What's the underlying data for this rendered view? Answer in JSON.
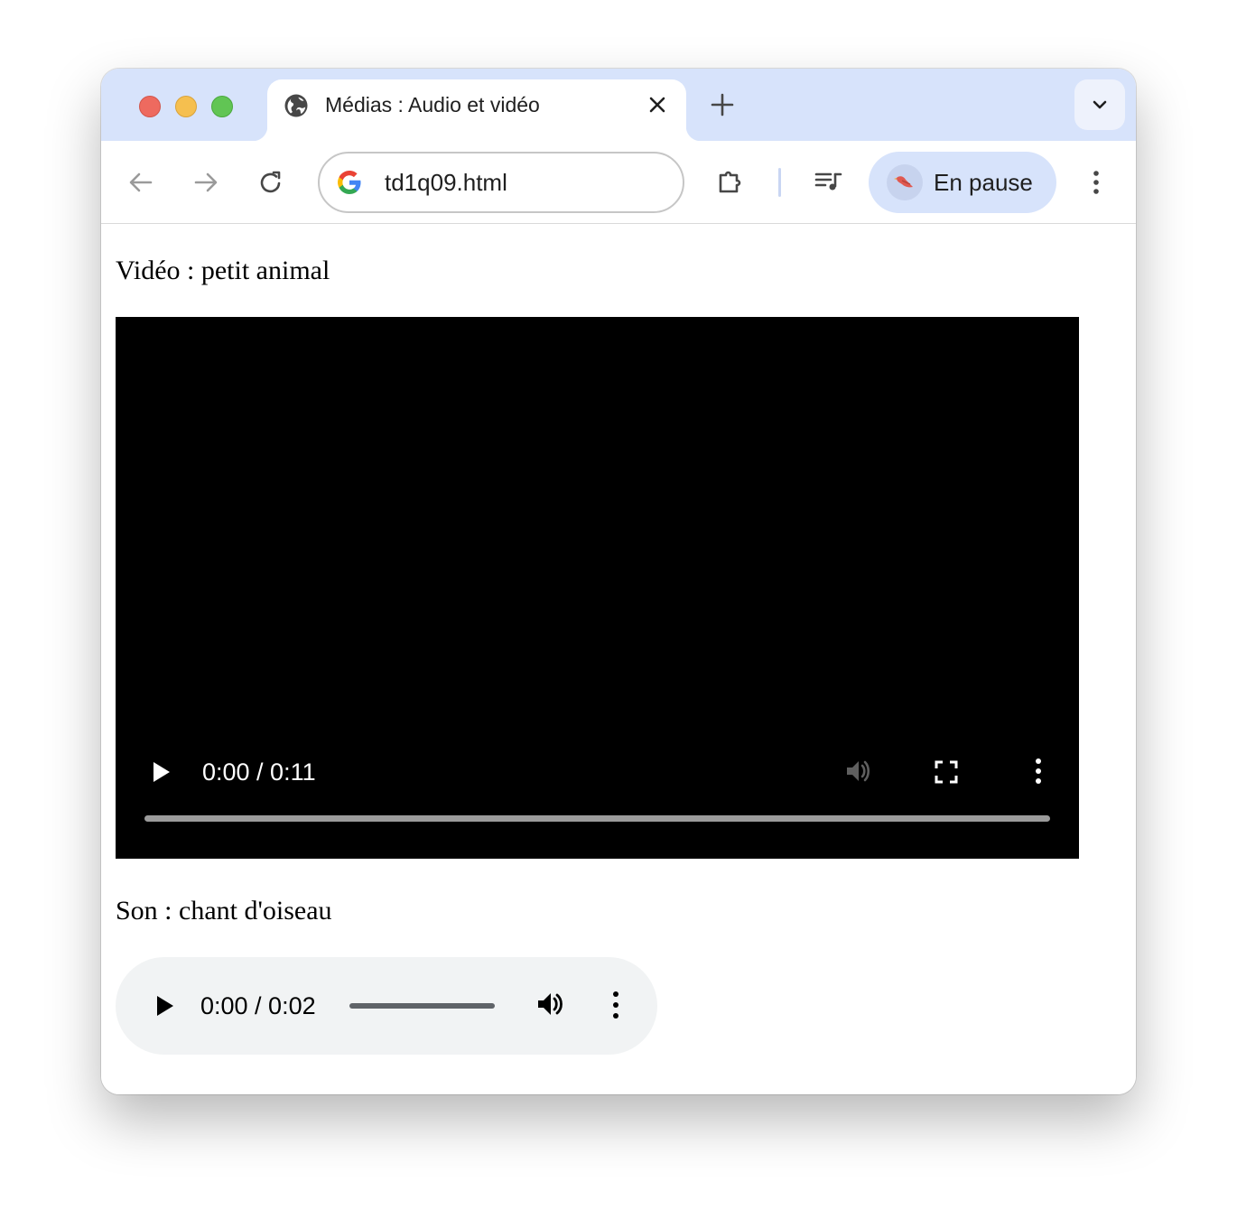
{
  "tab": {
    "title": "Médias : Audio et vidéo",
    "favicon": "globe-icon"
  },
  "toolbar": {
    "url": "td1q09.html",
    "profile_label": "En pause",
    "icons": [
      "back-icon",
      "forward-icon",
      "reload-icon",
      "google-icon",
      "extensions-icon",
      "media-controls-icon",
      "profile-avatar",
      "menu-icon"
    ]
  },
  "content": {
    "video_heading": "Vidéo : petit animal",
    "video": {
      "time": "0:00 / 0:11",
      "progress": 0,
      "controls": [
        "play-icon",
        "volume-icon",
        "fullscreen-icon",
        "more-options-icon"
      ]
    },
    "audio_heading": "Son : chant d'oiseau",
    "audio": {
      "time": "0:00 / 0:02",
      "progress": 0,
      "controls": [
        "play-icon",
        "volume-icon",
        "more-options-icon"
      ]
    }
  },
  "colors": {
    "tabstrip": "#d7e3fb",
    "profile_chip": "#d7e3fb",
    "audio_player_bg": "#f1f3f4",
    "video_bg": "#000000"
  }
}
